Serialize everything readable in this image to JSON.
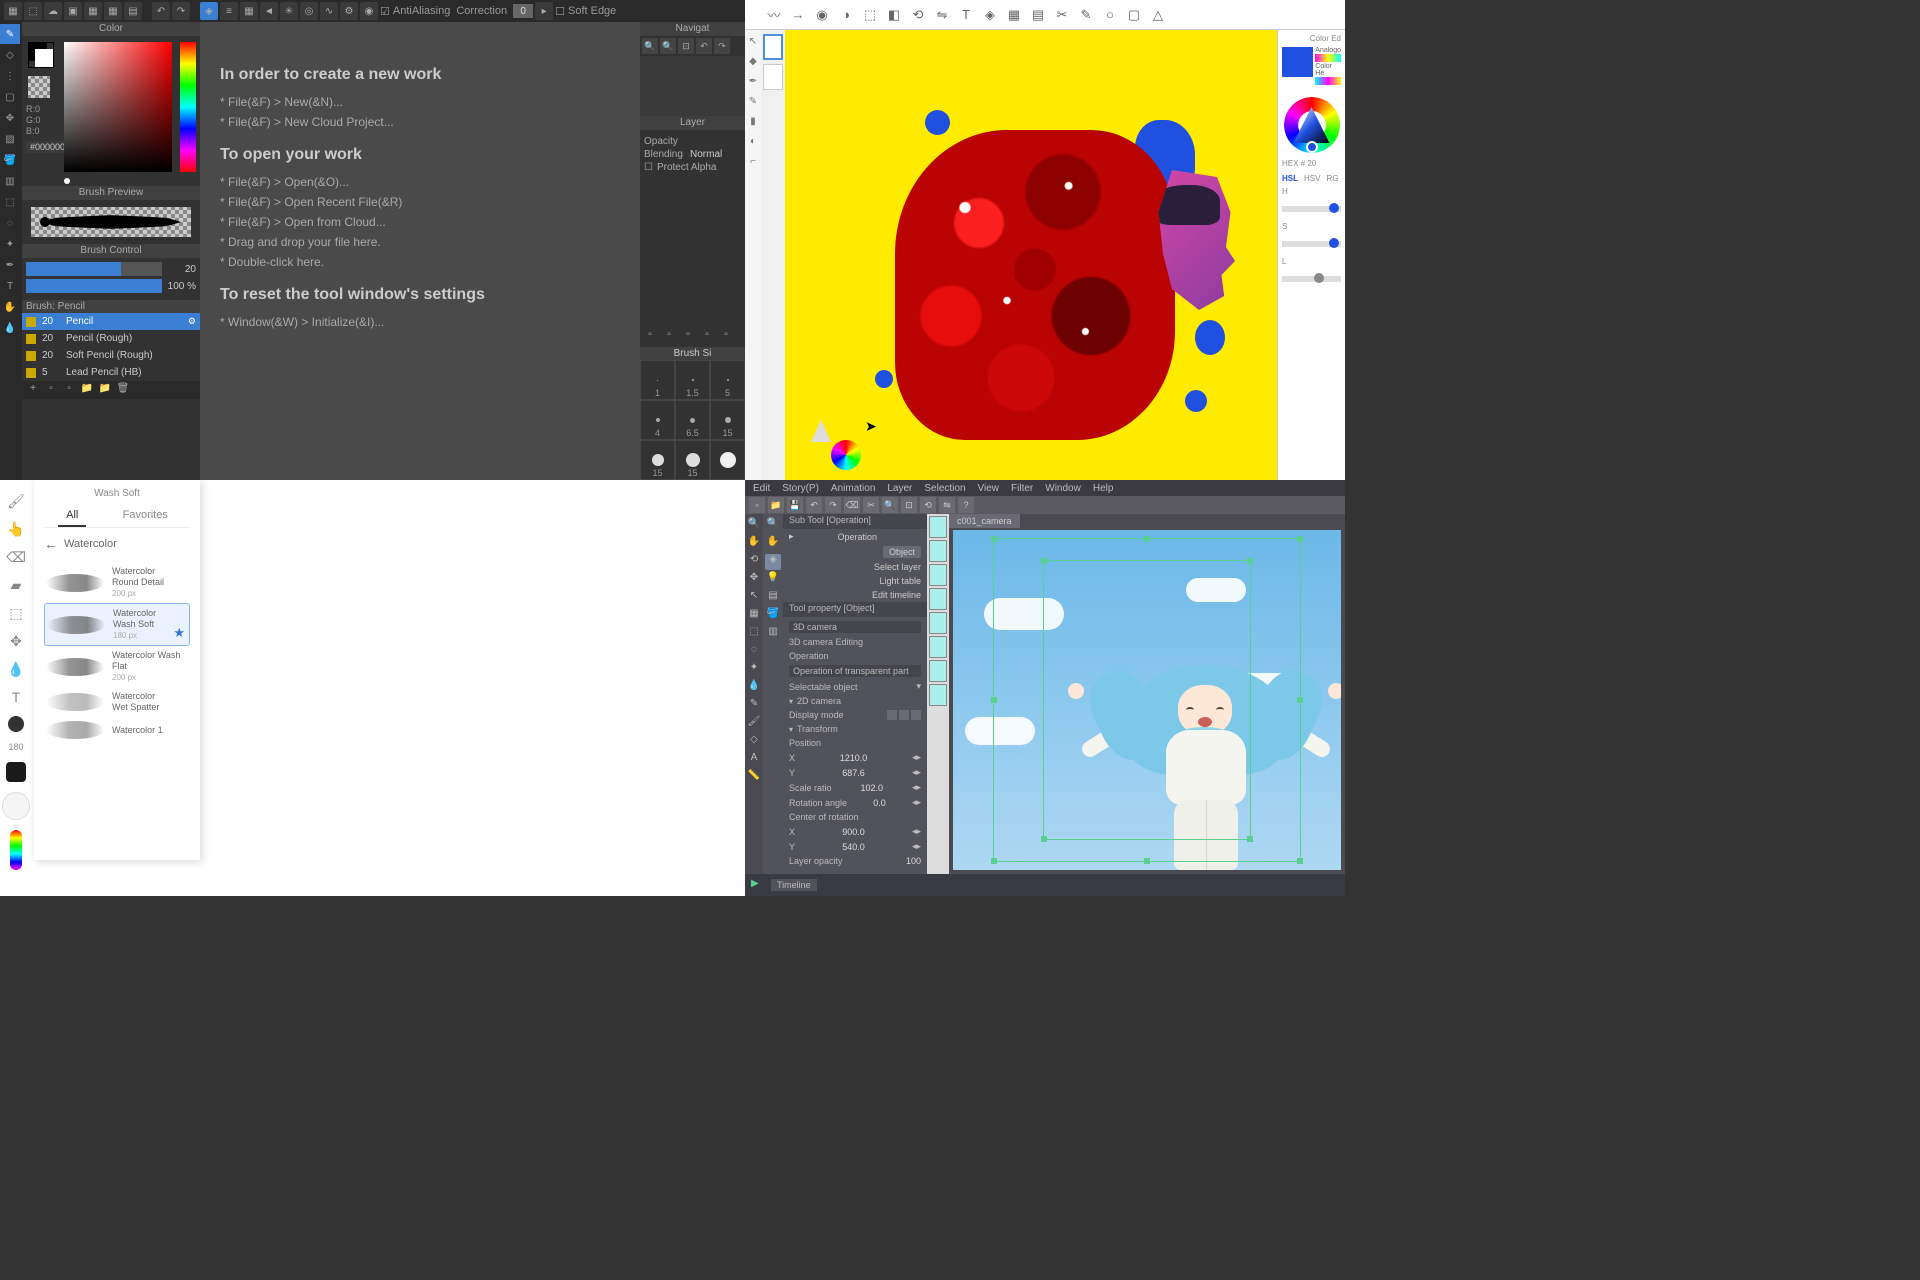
{
  "tl": {
    "topbar": {
      "antialiasing_label": "AntiAliasing",
      "correction_label": "Correction",
      "correction_value": "0",
      "softedge_label": "Soft Edge"
    },
    "color_panel_title": "Color",
    "rgb": "R:0\nG:0\nB:0",
    "hex": "#000000",
    "brush_preview_title": "Brush Preview",
    "brush_control_title": "Brush Control",
    "slider1_value": "20",
    "slider2_value": "100 %",
    "brush_list_title": "Brush: Pencil",
    "brushes": [
      {
        "size": "20",
        "name": "Pencil",
        "selected": true
      },
      {
        "size": "20",
        "name": "Pencil (Rough)"
      },
      {
        "size": "20",
        "name": "Soft Pencil (Rough)"
      },
      {
        "size": "5",
        "name": "Lead Pencil (HB)"
      }
    ],
    "canvas": {
      "h1": "In order to create a new work",
      "l1": "* File(&F) > New(&N)...",
      "l2": "* File(&F) > New Cloud Project...",
      "h2": "To open your work",
      "l3": "* File(&F) > Open(&O)...",
      "l4": "* File(&F) > Open Recent File(&R)",
      "l5": "* File(&F) > Open from Cloud...",
      "l6": "* Drag and drop your file here.",
      "l7": "* Double-click here.",
      "h3": "To reset the tool window's settings",
      "l8": "* Window(&W) > Initialize(&I)..."
    },
    "right": {
      "nav_title": "Navigat",
      "layer_title": "Layer",
      "opacity_label": "Opacity",
      "blending_label": "Blending",
      "blending_value": "Normal",
      "protect_alpha": "Protect Alpha",
      "brush_size_title": "Brush Si",
      "sizes": [
        "1",
        "1.5",
        "5",
        "4",
        "6.5",
        "15",
        "15",
        "15"
      ]
    }
  },
  "tr": {
    "color_ed_title": "Color Ed",
    "analog_label": "Analogo",
    "color2_label": "Color He",
    "hex_label": "HEX #",
    "hex_value": "20",
    "tabs": [
      "HSL",
      "HSV",
      "RG"
    ],
    "h_label": "H",
    "s_label": "S",
    "l_label": "L"
  },
  "bl": {
    "panel_title": "Wash Soft",
    "tab_all": "All",
    "tab_fav": "Favorites",
    "back_label": "Watercolor",
    "size_label": "180",
    "px_label": "180 px",
    "brushes": [
      {
        "name": "Watercolor\nRound Detail",
        "px": "200 px"
      },
      {
        "name": "Watercolor\nWash Soft",
        "px": "180 px",
        "selected": true,
        "star": true
      },
      {
        "name": "Watercolor Wash Flat",
        "px": "200 px"
      },
      {
        "name": "Watercolor\nWet Spatter",
        "px": ""
      },
      {
        "name": "Watercolor 1",
        "px": ""
      }
    ]
  },
  "br": {
    "menu": [
      "Edit",
      "Story(P)",
      "Animation",
      "Layer",
      "Selection",
      "View",
      "Filter",
      "Window",
      "Help"
    ],
    "subtool_title": "Sub Tool [Operation]",
    "tab_name": "c001_camera",
    "operation": "Operation",
    "object": "Object",
    "select_layer": "Select layer",
    "light_table": "Light table",
    "edit_timeline": "Edit timeline",
    "tool_prop_title": "Tool property [Object]",
    "camera": "3D camera",
    "camera_editing": "3D camera Editing",
    "operation2": "Operation",
    "op_trans": "Operation of transparent part",
    "selectable": "Selectable object",
    "sec_2d": "2D camera",
    "display_mode": "Display mode",
    "sec_transform": "Transform",
    "position": "Position",
    "x_label": "X",
    "x_val": "1210.0",
    "y_label": "Y",
    "y_val": "687.6",
    "scale_ratio": "Scale ratio",
    "scale_val": "102.0",
    "rotation_angle": "Rotation angle",
    "rot_val": "0.0",
    "center_rotation": "Center of rotation",
    "cx_label": "X",
    "cx_val": "900.0",
    "cy_label": "Y",
    "cy_val": "540.0",
    "layer_opacity": "Layer opacity",
    "opacity_val": "100",
    "timeline": "Timeline"
  }
}
